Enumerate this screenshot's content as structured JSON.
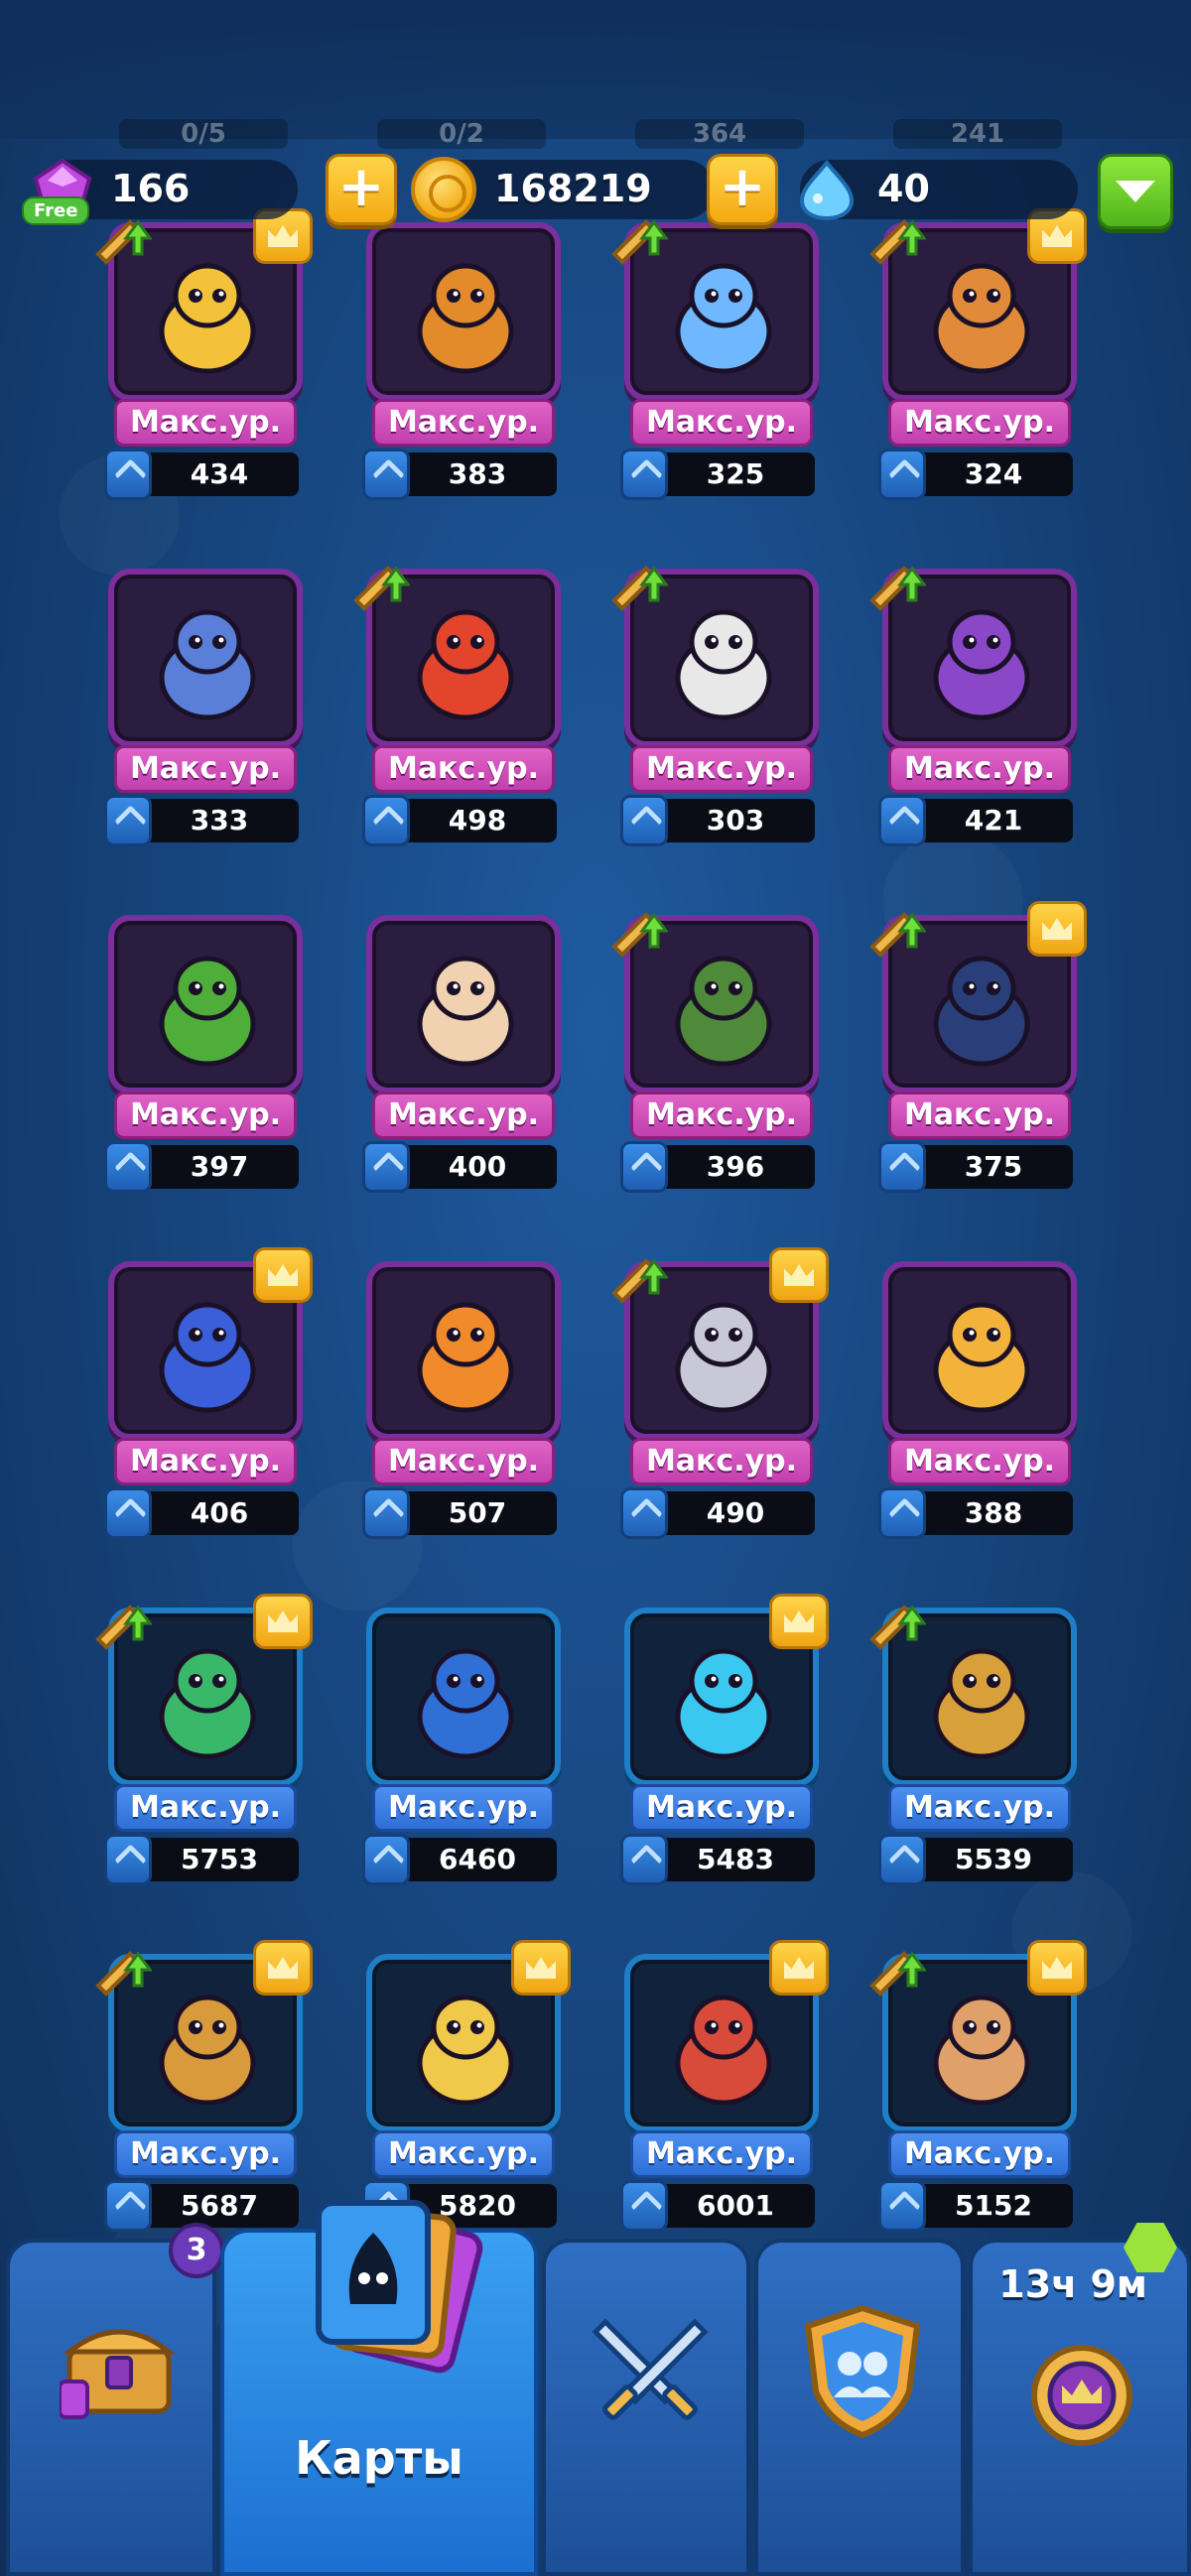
{
  "ghost_header": [
    "0/5",
    "0/2",
    "364",
    "241"
  ],
  "resources": {
    "gems": "166",
    "free_label": "Free",
    "coins": "168219",
    "drops": "40"
  },
  "colors": {
    "purple_card": "#7a2f9c",
    "blue_card": "#1e7fc8",
    "level_pink": "#c13fae",
    "level_blue": "#2e6fd6",
    "accent_gold": "#f4a911",
    "accent_green": "#4fb51d"
  },
  "cards": [
    {
      "level": "Макс.ур.",
      "count": "434",
      "rarity": "purple",
      "upgrade": true,
      "crown": true,
      "hero": "wizard-icon",
      "color": "#f3c23a"
    },
    {
      "level": "Макс.ур.",
      "count": "383",
      "rarity": "purple",
      "upgrade": false,
      "crown": false,
      "hero": "totem-icon",
      "color": "#e38a2a"
    },
    {
      "level": "Макс.ур.",
      "count": "325",
      "rarity": "purple",
      "upgrade": true,
      "crown": false,
      "hero": "robot-icon",
      "color": "#6fb8ff"
    },
    {
      "level": "Макс.ур.",
      "count": "324",
      "rarity": "purple",
      "upgrade": true,
      "crown": true,
      "hero": "engineer-icon",
      "color": "#e08a3a"
    },
    {
      "level": "Макс.ур.",
      "count": "333",
      "rarity": "purple",
      "upgrade": false,
      "crown": false,
      "hero": "gargoyle-icon",
      "color": "#5a7fd8"
    },
    {
      "level": "Макс.ур.",
      "count": "498",
      "rarity": "purple",
      "upgrade": true,
      "crown": false,
      "hero": "executioner-icon",
      "color": "#e2452b"
    },
    {
      "level": "Макс.ур.",
      "count": "303",
      "rarity": "purple",
      "upgrade": true,
      "crown": false,
      "hero": "jester-icon",
      "color": "#e8e8e8"
    },
    {
      "level": "Макс.ур.",
      "count": "421",
      "rarity": "purple",
      "upgrade": true,
      "crown": false,
      "hero": "plague-doctor-icon",
      "color": "#8a48c8"
    },
    {
      "level": "Макс.ур.",
      "count": "397",
      "rarity": "purple",
      "upgrade": false,
      "crown": false,
      "hero": "dryad-icon",
      "color": "#4fae3a"
    },
    {
      "level": "Макс.ур.",
      "count": "400",
      "rarity": "purple",
      "upgrade": false,
      "crown": false,
      "hero": "sage-icon",
      "color": "#f0d2b0"
    },
    {
      "level": "Макс.ур.",
      "count": "396",
      "rarity": "purple",
      "upgrade": true,
      "crown": false,
      "hero": "goblin-icon",
      "color": "#4f8a3a"
    },
    {
      "level": "Макс.ур.",
      "count": "375",
      "rarity": "purple",
      "upgrade": true,
      "crown": true,
      "hero": "reaper-icon",
      "color": "#2a3f7a"
    },
    {
      "level": "Макс.ур.",
      "count": "406",
      "rarity": "purple",
      "upgrade": false,
      "crown": true,
      "hero": "monk-icon",
      "color": "#3a5fd8"
    },
    {
      "level": "Макс.ур.",
      "count": "507",
      "rarity": "purple",
      "upgrade": false,
      "crown": false,
      "hero": "fire-spirit-icon",
      "color": "#f08a2a"
    },
    {
      "level": "Макс.ур.",
      "count": "490",
      "rarity": "purple",
      "upgrade": true,
      "crown": true,
      "hero": "vampire-icon",
      "color": "#c8c8d8"
    },
    {
      "level": "Макс.ур.",
      "count": "388",
      "rarity": "purple",
      "upgrade": false,
      "crown": false,
      "hero": "bird-icon",
      "color": "#f3b23a"
    },
    {
      "level": "Макс.ур.",
      "count": "5753",
      "rarity": "blue",
      "upgrade": true,
      "crown": true,
      "hero": "shaman-icon",
      "color": "#3ab86a"
    },
    {
      "level": "Макс.ур.",
      "count": "6460",
      "rarity": "blue",
      "upgrade": false,
      "crown": false,
      "hero": "banner-icon",
      "color": "#2f6fd6"
    },
    {
      "level": "Макс.ур.",
      "count": "5483",
      "rarity": "blue",
      "upgrade": false,
      "crown": true,
      "hero": "potion-icon",
      "color": "#3ac8f0"
    },
    {
      "level": "Макс.ур.",
      "count": "5539",
      "rarity": "blue",
      "upgrade": true,
      "crown": false,
      "hero": "golem-icon",
      "color": "#d8a03a"
    },
    {
      "level": "Макс.ур.",
      "count": "5687",
      "rarity": "blue",
      "upgrade": true,
      "crown": true,
      "hero": "chest-icon",
      "color": "#d89a3a"
    },
    {
      "level": "Макс.ур.",
      "count": "5820",
      "rarity": "blue",
      "upgrade": false,
      "crown": true,
      "hero": "angel-icon",
      "color": "#f0c84a"
    },
    {
      "level": "Макс.ур.",
      "count": "6001",
      "rarity": "blue",
      "upgrade": false,
      "crown": true,
      "hero": "knight-icon",
      "color": "#d84a3a"
    },
    {
      "level": "Макс.ур.",
      "count": "5152",
      "rarity": "blue",
      "upgrade": true,
      "crown": true,
      "hero": "dwarf-icon",
      "color": "#e0a06a"
    }
  ],
  "nav": {
    "chest_badge": "3",
    "cards_label": "Карты",
    "timer": "13ч 9м"
  }
}
